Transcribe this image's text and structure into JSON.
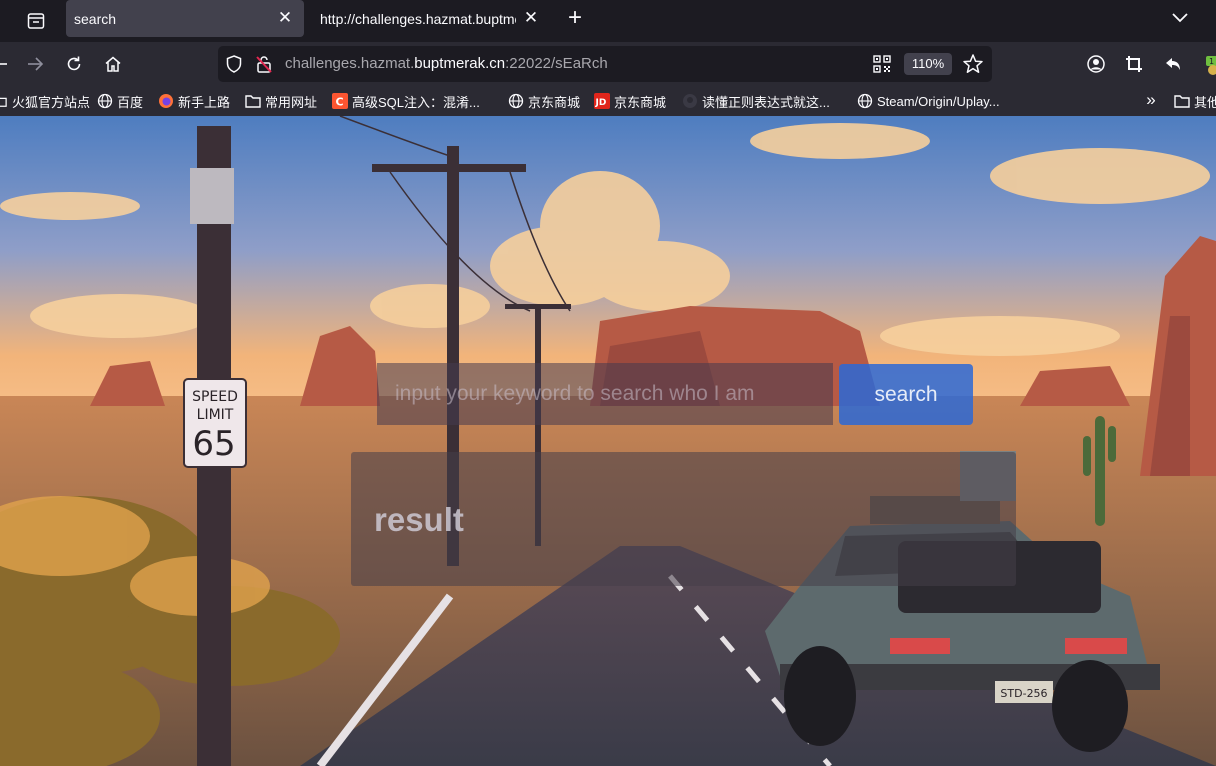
{
  "tabs": [
    {
      "title": "search",
      "active": true
    },
    {
      "title": "http://challenges.hazmat.buptme",
      "active": false
    }
  ],
  "url": {
    "prefix": "challenges.hazmat.",
    "host": "buptmerak.cn",
    "suffix": ":22022/sEaRch"
  },
  "zoom": "110%",
  "bookmarks": [
    {
      "label": "火狐官方站点",
      "icon": "folder-icon"
    },
    {
      "label": "百度",
      "icon": "globe-icon"
    },
    {
      "label": "新手上路",
      "icon": "firefox-icon"
    },
    {
      "label": "常用网址",
      "icon": "folder-icon"
    },
    {
      "label": "高级SQL注入：混淆...",
      "icon": "csdn-icon"
    },
    {
      "label": "京东商城",
      "icon": "globe-icon"
    },
    {
      "label": "京东商城",
      "icon": "jd-icon"
    },
    {
      "label": "读懂正则表达式就这...",
      "icon": "github-icon"
    },
    {
      "label": "Steam/Origin/Uplay...",
      "icon": "globe-icon"
    },
    {
      "label": "其他",
      "icon": "folder-icon"
    }
  ],
  "page": {
    "search_placeholder": "input your keyword to search who I am",
    "search_button": "search",
    "result_title": "result"
  },
  "scene": {
    "sign_line1": "SPEED",
    "sign_line2": "LIMIT",
    "sign_value": "65",
    "plate": "STD-256"
  },
  "colors": {
    "tabbar": "#1c1b22",
    "toolbar": "#2b2a33",
    "active_tab": "#42414d",
    "search_button": "#2c68d6"
  }
}
